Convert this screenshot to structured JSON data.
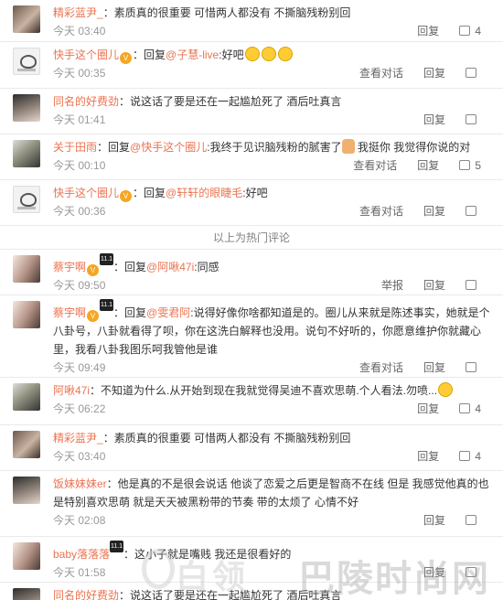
{
  "ui": {
    "reply": "回复",
    "view_conversation": "查看对话",
    "report": "举报",
    "like_icon": "thumb-up-icon"
  },
  "separator": "以上为热门评论",
  "comments": [
    {
      "user": "精彩蓝尹_",
      "text": "：素质真的很重要 可惜两人都没有 不撕脑残粉别回",
      "time": "今天 03:40",
      "likes": "4"
    },
    {
      "user": "快手这个圈儿",
      "reply_to": "@子慧-live",
      "text": ":好吧",
      "time": "今天 00:35",
      "likes": ""
    },
    {
      "user": "同名的好费劲",
      "text": "：说这话了要是还在一起尴尬死了 酒后吐真言",
      "time": "今天 01:41",
      "likes": ""
    },
    {
      "user": "关于田雨",
      "reply_to": "@快手这个圈儿",
      "text": ":我终于见识脑残粉的腻害了",
      "text2": "我挺你 我觉得你说的对",
      "time": "今天 00:10",
      "likes": "5"
    },
    {
      "user": "快手这个圈儿",
      "reply_to": "@轩轩的眼睫毛",
      "text": ":好吧",
      "time": "今天 00:36",
      "likes": ""
    },
    {
      "user": "蔡宇啊",
      "reply_to": "@阿啾47i",
      "text": ":同感",
      "time": "今天 09:50",
      "likes": ""
    },
    {
      "user": "蔡宇啊",
      "reply_to": "@雯君阿",
      "text": ":说得好像你啥都知道是的。圈儿从来就是陈述事实，她就是个八卦号，八卦就看得了呗，你在这洗白解释也没用。说句不好听的，你愿意维护你就藏心里，我看八卦我图乐呵我管他是谁",
      "time": "今天 09:49",
      "likes": ""
    },
    {
      "user": "阿啾47i",
      "text": "：不知道为什么.从开始到现在我就觉得吴迪不喜欢思萌.个人看法.勿喷...",
      "time": "今天 06:22",
      "likes": "4"
    },
    {
      "user": "精彩蓝尹_",
      "text": "：素质真的很重要 可惜两人都没有 不撕脑残粉别回",
      "time": "今天 03:40",
      "likes": "4"
    },
    {
      "user": "饭妹妹妹er",
      "text": "：他是真的不是很会说话 他谈了恋爱之后更是智商不在线 但是 我感觉他真的也是特别喜欢思萌 就是天天被黑粉带的节奏 带的太烦了 心情不好",
      "time": "今天 02:08",
      "likes": ""
    },
    {
      "user": "baby落落落",
      "text": "：这小子就是嘴贱 我还是很看好的",
      "time": "今天 01:58",
      "likes": ""
    },
    {
      "user": "同名的好费劲",
      "text": "：说这话了要是还在一起尴尬死了 酒后吐真言",
      "time": "",
      "likes": ""
    }
  ],
  "watermark": {
    "left": "白领",
    "right": "巴陵时尚网"
  }
}
